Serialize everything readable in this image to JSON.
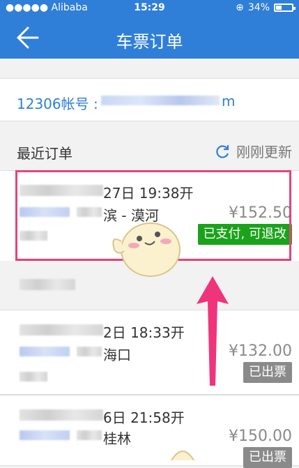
{
  "status_bar": {
    "carrier": "●●●●● Alibaba",
    "time": "15:29",
    "battery": "34%"
  },
  "navbar": {
    "back_icon": "back-arrow-icon",
    "title": "车票订单"
  },
  "account": {
    "label": "12306帐号 :",
    "tail": "m"
  },
  "recent": {
    "label": "最近订单",
    "refresh_label": "刚刚更新"
  },
  "orders": [
    {
      "date": "27日 19:38开",
      "route": "滨 - 漠河",
      "price": "¥152.50",
      "status": "已支付, 可退改"
    },
    {
      "date": "2日 18:33开",
      "route": "海口",
      "price": "¥132.00",
      "status": "已出票"
    },
    {
      "date": "6日 21:58开",
      "route": "桂林",
      "price": "¥150.00",
      "status": "已出票"
    }
  ],
  "colors": {
    "accent": "#2f7fd8",
    "status_green": "#1aa31a",
    "status_gray": "#8a8a8a",
    "highlight": "#e2447a"
  }
}
